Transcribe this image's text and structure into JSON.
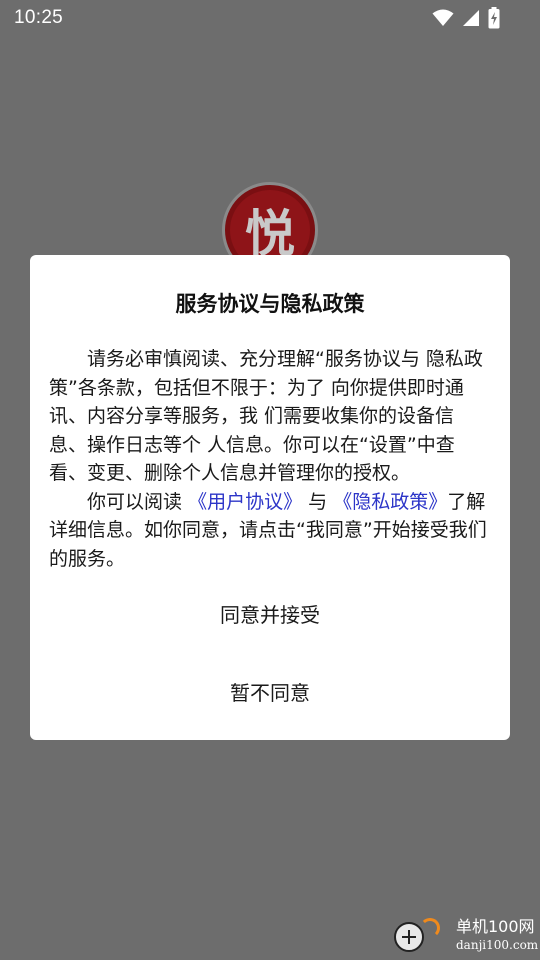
{
  "status_bar": {
    "time": "10:25",
    "icons": [
      "wifi-icon",
      "signal-icon",
      "battery-charging-icon"
    ]
  },
  "app_logo": {
    "glyph": "悦"
  },
  "dialog": {
    "title": "服务协议与隐私政策",
    "paragraph1": "请务必审慎阅读、充分理解“服务协议与 隐私政策”各条款，包括但不限于：为了 向你提供即时通讯、内容分享等服务，我 们需要收集你的设备信息、操作日志等个 人信息。你可以在“设置”中查看、变更、删除个人信息并管理你的授权。",
    "paragraph2_prefix": "你可以阅读",
    "user_agreement_link": "《用户协议》",
    "paragraph2_mid": "与",
    "privacy_policy_link": "《隐私政策》",
    "paragraph2_suffix": "了解详细信息。如你同意，请点击“我同意”开始接受我们的服务。",
    "agree_button": "同意并接受",
    "disagree_button": "暂不同意"
  },
  "watermark": {
    "line1": "单机100网",
    "line2": "danji100.com"
  },
  "colors": {
    "overlay": "#6d6d6d",
    "link": "#2c35c8",
    "dialog_bg": "#ffffff"
  }
}
